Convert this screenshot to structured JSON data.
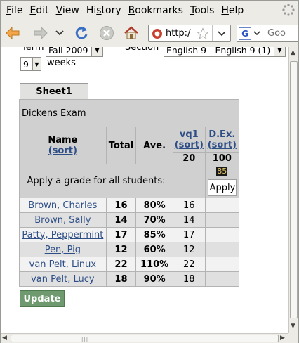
{
  "menu": [
    "File",
    "Edit",
    "View",
    "History",
    "Bookmarks",
    "Tools",
    "Help"
  ],
  "menu_underline": [
    "F",
    "E",
    "V",
    "s",
    "B",
    "T",
    "H"
  ],
  "url": {
    "value": "http:/"
  },
  "search": {
    "placeholder": "Goo"
  },
  "term": {
    "label": "Term",
    "value": "Fall 2009"
  },
  "section": {
    "label": "Section",
    "value": "English 9 - English 9 (1)"
  },
  "weeks": {
    "value": "9",
    "label": "weeks"
  },
  "sheet_tab": "Sheet1",
  "exam_title": "Dickens Exam",
  "headers": {
    "name": "Name",
    "name_sort": "(sort)",
    "total": "Total",
    "ave": "Ave.",
    "col1": "vq1",
    "col1_sort": "(sort)",
    "col1_max": "20",
    "col2": "D.Ex.",
    "col2_sort": "(sort)",
    "col2_max": "100"
  },
  "apply_row": {
    "label": "Apply a grade for all students:",
    "value": "85",
    "button": "Apply"
  },
  "students": [
    {
      "name": "Brown, Charles",
      "total": "16",
      "ave": "80%",
      "vq1": "16"
    },
    {
      "name": "Brown, Sally",
      "total": "14",
      "ave": "70%",
      "vq1": "14"
    },
    {
      "name": "Patty, Peppermint",
      "total": "17",
      "ave": "85%",
      "vq1": "17"
    },
    {
      "name": "Pen, Pig",
      "total": "12",
      "ave": "60%",
      "vq1": "12"
    },
    {
      "name": "van Pelt, Linux",
      "total": "22",
      "ave": "110%",
      "vq1": "22"
    },
    {
      "name": "van Pelt, Lucy",
      "total": "18",
      "ave": "90%",
      "vq1": "18"
    }
  ],
  "update_label": "Update"
}
